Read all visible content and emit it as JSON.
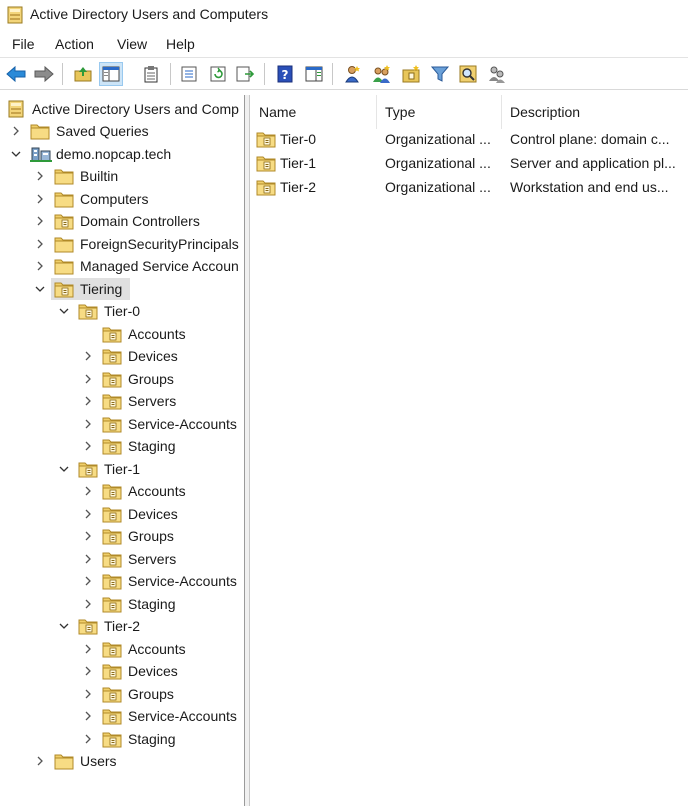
{
  "window": {
    "title": "Active Directory Users and Computers"
  },
  "menu": {
    "file": "File",
    "action": "Action",
    "view": "View",
    "help": "Help"
  },
  "tree": {
    "root": "Active Directory Users and Comp",
    "saved_queries": "Saved Queries",
    "domain": "demo.nopcap.tech",
    "builtin": "Builtin",
    "computers": "Computers",
    "domain_controllers": "Domain Controllers",
    "fsp": "ForeignSecurityPrincipals",
    "msa": "Managed Service Accoun",
    "tiering": "Tiering",
    "tier0": {
      "label": "Tier-0",
      "accounts": "Accounts",
      "devices": "Devices",
      "groups": "Groups",
      "servers": "Servers",
      "service_accounts": "Service-Accounts",
      "staging": "Staging"
    },
    "tier1": {
      "label": "Tier-1",
      "accounts": "Accounts",
      "devices": "Devices",
      "groups": "Groups",
      "servers": "Servers",
      "service_accounts": "Service-Accounts",
      "staging": "Staging"
    },
    "tier2": {
      "label": "Tier-2",
      "accounts": "Accounts",
      "devices": "Devices",
      "groups": "Groups",
      "service_accounts": "Service-Accounts",
      "staging": "Staging"
    },
    "users": "Users"
  },
  "list": {
    "columns": {
      "name": "Name",
      "type": "Type",
      "description": "Description"
    },
    "rows": [
      {
        "name": "Tier-0",
        "type": "Organizational ...",
        "description": "Control plane: domain c..."
      },
      {
        "name": "Tier-1",
        "type": "Organizational ...",
        "description": "Server and application pl..."
      },
      {
        "name": "Tier-2",
        "type": "Organizational ...",
        "description": "Workstation and end us..."
      }
    ]
  },
  "toolbar": {
    "icons": [
      "back-icon",
      "forward-icon",
      "up-folder-icon",
      "show-hide-console-tree-icon",
      "properties-sheet-icon",
      "export-list-icon",
      "refresh-icon",
      "export-arrow-icon",
      "help-icon",
      "action-pane-icon",
      "new-user-icon",
      "new-group-icon",
      "new-ou-icon",
      "filter-icon",
      "find-icon",
      "add-to-group-icon"
    ]
  },
  "colors": {
    "selection": "#e0e0e0",
    "folder": "#e8c65a",
    "accent": "#1e78d7"
  }
}
